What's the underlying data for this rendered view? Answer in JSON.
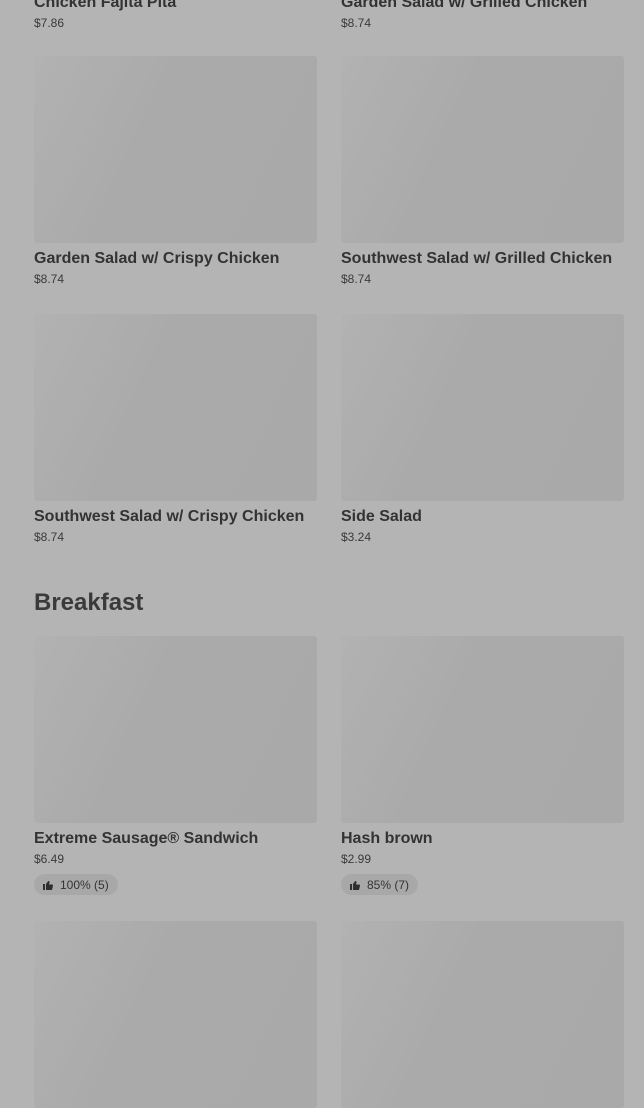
{
  "top_items": [
    {
      "name": "Chicken Fajita Pita",
      "price": "$7.86"
    },
    {
      "name": "Garden Salad w/ Grilled Chicken",
      "price": "$8.74"
    }
  ],
  "items": [
    {
      "name": "Garden Salad w/ Crispy Chicken",
      "price": "$8.74"
    },
    {
      "name": "Southwest Salad w/ Grilled Chicken",
      "price": "$8.74"
    },
    {
      "name": "Southwest Salad w/ Crispy Chicken",
      "price": "$8.74"
    },
    {
      "name": "Side Salad",
      "price": "$3.24"
    }
  ],
  "breakfast": {
    "title": "Breakfast",
    "items": [
      {
        "name": "Extreme Sausage® Sandwich",
        "price": "$6.49",
        "rating": "100% (5)"
      },
      {
        "name": "Hash brown",
        "price": "$2.99",
        "rating": "85% (7)"
      }
    ]
  },
  "icons": {
    "rating": "thumbs-up-icon"
  },
  "colors": {
    "background": "#b4b4b4",
    "placeholder": "#aaaaaa",
    "text": "#333333"
  }
}
